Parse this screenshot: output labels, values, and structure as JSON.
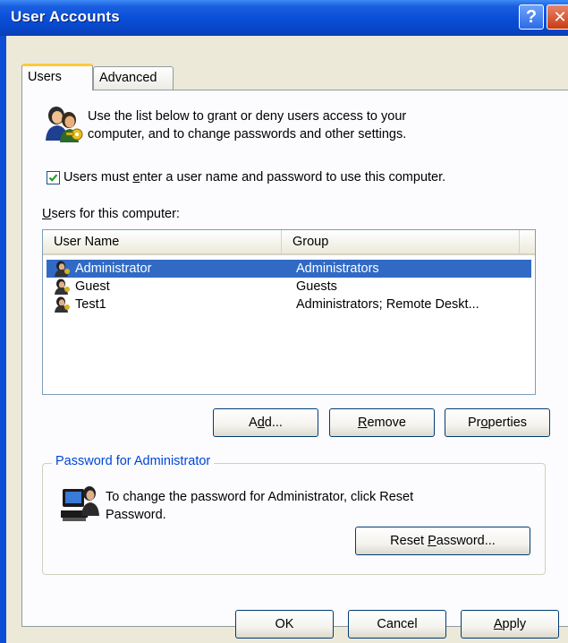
{
  "window": {
    "title": "User Accounts",
    "help_glyph": "?",
    "close_glyph": "✕"
  },
  "tabs": [
    {
      "label": "Users",
      "active": true
    },
    {
      "label": "Advanced",
      "active": false
    }
  ],
  "intro": {
    "line1": "Use the list below to grant or deny users access to your",
    "line2": "computer, and to change passwords and other settings.",
    "icon": "users-key-icon"
  },
  "require_login": {
    "checked": true,
    "label_before": "Users must ",
    "label_mnemonic": "e",
    "label_after": "nter a user name and password to use this computer."
  },
  "users_list": {
    "label_mnemonic": "U",
    "label_rest": "sers for this computer:",
    "columns": [
      "User Name",
      "Group"
    ],
    "rows": [
      {
        "name": "Administrator",
        "group": "Administrators",
        "selected": true
      },
      {
        "name": "Guest",
        "group": "Guests",
        "selected": false
      },
      {
        "name": "Test1",
        "group": "Administrators; Remote Deskt...",
        "selected": false
      }
    ]
  },
  "list_buttons": {
    "add": {
      "pre": "A",
      "mn": "d",
      "post": "d..."
    },
    "remove": {
      "pre": "",
      "mn": "R",
      "post": "emove"
    },
    "properties": {
      "pre": "Pr",
      "mn": "o",
      "post": "perties"
    }
  },
  "password_group": {
    "legend": "Password for Administrator",
    "line1": "To change the password for Administrator, click Reset",
    "line2": "Password.",
    "reset": {
      "pre": "Reset ",
      "mn": "P",
      "post": "assword..."
    },
    "icon": "computer-user-icon"
  },
  "dialog_buttons": {
    "ok": "OK",
    "cancel": "Cancel",
    "apply": {
      "pre": "",
      "mn": "A",
      "post": "pply"
    }
  },
  "colors": {
    "selection": "#316ac5",
    "title_bar": "#0a4fd8",
    "dialog_face": "#ece9d8",
    "legend_text": "#0046d5"
  }
}
